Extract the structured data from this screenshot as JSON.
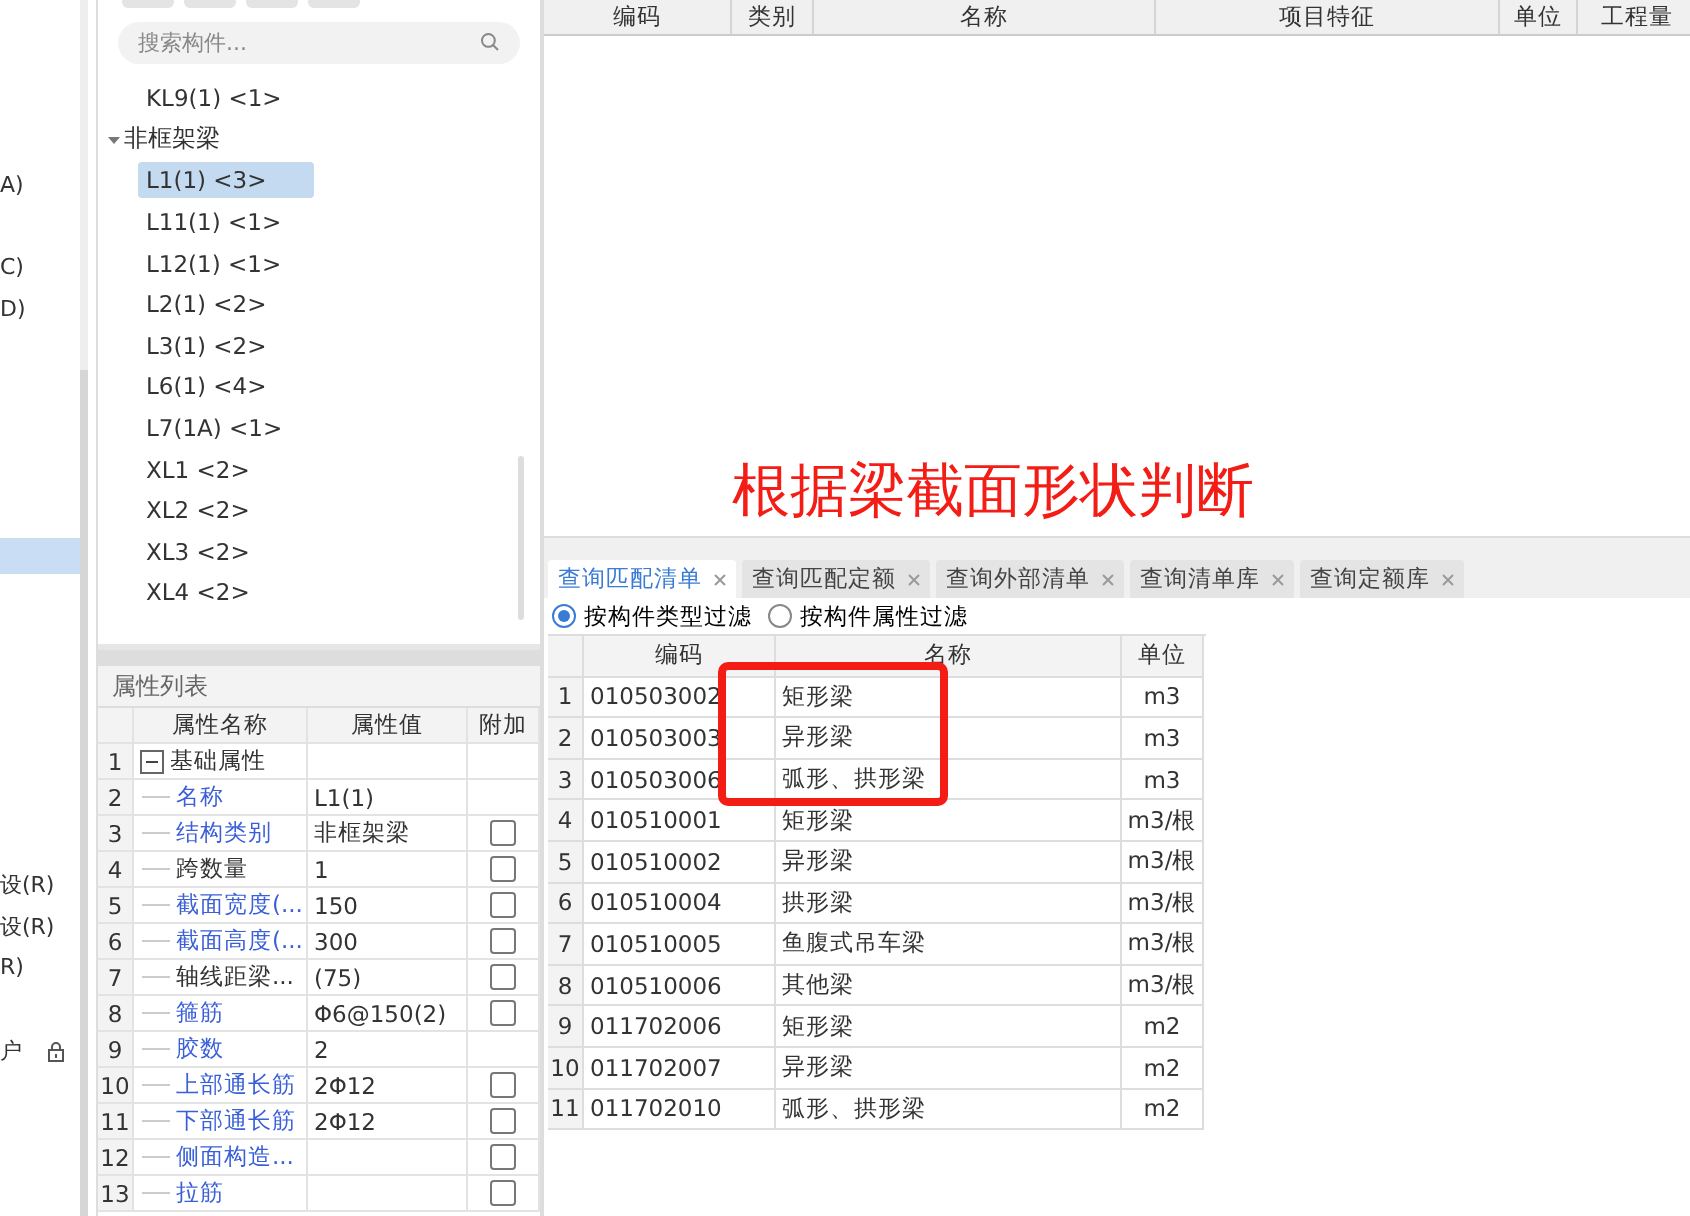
{
  "left_strip": {
    "items": [
      {
        "kind": "text",
        "text": "A)"
      },
      {
        "kind": "text",
        "text": "C)"
      },
      {
        "kind": "text",
        "text": "D)"
      },
      {
        "kind": "selection"
      },
      {
        "kind": "text",
        "text": "设(R)"
      },
      {
        "kind": "text",
        "text": "设(R)"
      },
      {
        "kind": "text",
        "text": "R)"
      },
      {
        "kind": "text_lock",
        "text": "户"
      }
    ]
  },
  "component_panel": {
    "search": {
      "placeholder": "搜索构件..."
    },
    "tree": [
      {
        "label": "KL9(1) <1>",
        "selected": false
      },
      {
        "label": "非框架梁",
        "expanded": true,
        "children": [
          {
            "label": "L1(1) <3>",
            "selected": true
          },
          {
            "label": "L11(1) <1>",
            "selected": false
          },
          {
            "label": "L12(1) <1>",
            "selected": false
          },
          {
            "label": "L2(1) <2>",
            "selected": false
          },
          {
            "label": "L3(1) <2>",
            "selected": false
          },
          {
            "label": "L6(1) <4>",
            "selected": false
          },
          {
            "label": "L7(1A) <1>",
            "selected": false
          },
          {
            "label": "XL1 <2>",
            "selected": false
          },
          {
            "label": "XL2 <2>",
            "selected": false
          },
          {
            "label": "XL3 <2>",
            "selected": false
          },
          {
            "label": "XL4 <2>",
            "selected": false
          }
        ]
      }
    ]
  },
  "properties": {
    "title": "属性列表",
    "columns": [
      "属性名称",
      "属性值",
      "附加"
    ],
    "rows": [
      {
        "num": "1",
        "kind": "group",
        "name": "基础属性",
        "expanded": true
      },
      {
        "num": "2",
        "kind": "prop",
        "name": "名称",
        "public": true,
        "value": "L1(1)"
      },
      {
        "num": "3",
        "kind": "prop",
        "name": "结构类别",
        "public": true,
        "value": "非框架梁",
        "checked": false
      },
      {
        "num": "4",
        "kind": "prop",
        "name": "跨数量",
        "public": false,
        "value": "1",
        "checked": false
      },
      {
        "num": "5",
        "kind": "prop",
        "name": "截面宽度(...",
        "public": true,
        "value": "150",
        "checked": false
      },
      {
        "num": "6",
        "kind": "prop",
        "name": "截面高度(...",
        "public": true,
        "value": "300",
        "checked": false
      },
      {
        "num": "7",
        "kind": "prop",
        "name": "轴线距梁...",
        "public": false,
        "value": "(75)",
        "checked": false
      },
      {
        "num": "8",
        "kind": "prop",
        "name": "箍筋",
        "public": true,
        "value": "Φ6@150(2)",
        "checked": false
      },
      {
        "num": "9",
        "kind": "prop",
        "name": "胶数",
        "public": true,
        "value": "2"
      },
      {
        "num": "10",
        "kind": "prop",
        "name": "上部通长筋",
        "public": true,
        "value": "2Φ12",
        "checked": false
      },
      {
        "num": "11",
        "kind": "prop",
        "name": "下部通长筋",
        "public": true,
        "value": "2Φ12",
        "checked": false
      },
      {
        "num": "12",
        "kind": "prop",
        "name": "侧面构造...",
        "public": true,
        "checked": false
      },
      {
        "num": "13",
        "kind": "prop",
        "name": "拉筋",
        "public": true,
        "checked": false
      }
    ]
  },
  "bill_table": {
    "columns": [
      "编码",
      "类别",
      "名称",
      "项目特征",
      "单位",
      "工程量"
    ]
  },
  "annotation": {
    "text": "根据梁截面形状判断"
  },
  "query_tabs": [
    {
      "label": "查询匹配清单",
      "selected": true
    },
    {
      "label": "查询匹配定额",
      "selected": false
    },
    {
      "label": "查询外部清单",
      "selected": false
    },
    {
      "label": "查询清单库",
      "selected": false
    },
    {
      "label": "查询定额库",
      "selected": false
    }
  ],
  "filters": [
    {
      "label": "按构件类型过滤",
      "selected": true
    },
    {
      "label": "按构件属性过滤",
      "selected": false
    }
  ],
  "match_table": {
    "columns": [
      "编码",
      "名称",
      "单位"
    ],
    "rows": [
      {
        "num": "1",
        "code": "010503002",
        "name": "矩形梁",
        "unit": "m3"
      },
      {
        "num": "2",
        "code": "010503003",
        "name": "异形梁",
        "unit": "m3"
      },
      {
        "num": "3",
        "code": "010503006",
        "name": "弧形、拱形梁",
        "unit": "m3"
      },
      {
        "num": "4",
        "code": "010510001",
        "name": "矩形梁",
        "unit": "m3/根"
      },
      {
        "num": "5",
        "code": "010510002",
        "name": "异形梁",
        "unit": "m3/根"
      },
      {
        "num": "6",
        "code": "010510004",
        "name": "拱形梁",
        "unit": "m3/根"
      },
      {
        "num": "7",
        "code": "010510005",
        "name": "鱼腹式吊车梁",
        "unit": "m3/根"
      },
      {
        "num": "8",
        "code": "010510006",
        "name": "其他梁",
        "unit": "m3/根"
      },
      {
        "num": "9",
        "code": "011702006",
        "name": "矩形梁",
        "unit": "m2"
      },
      {
        "num": "10",
        "code": "011702007",
        "name": "异形梁",
        "unit": "m2"
      },
      {
        "num": "11",
        "code": "011702010",
        "name": "弧形、拱形梁",
        "unit": "m2"
      }
    ]
  }
}
